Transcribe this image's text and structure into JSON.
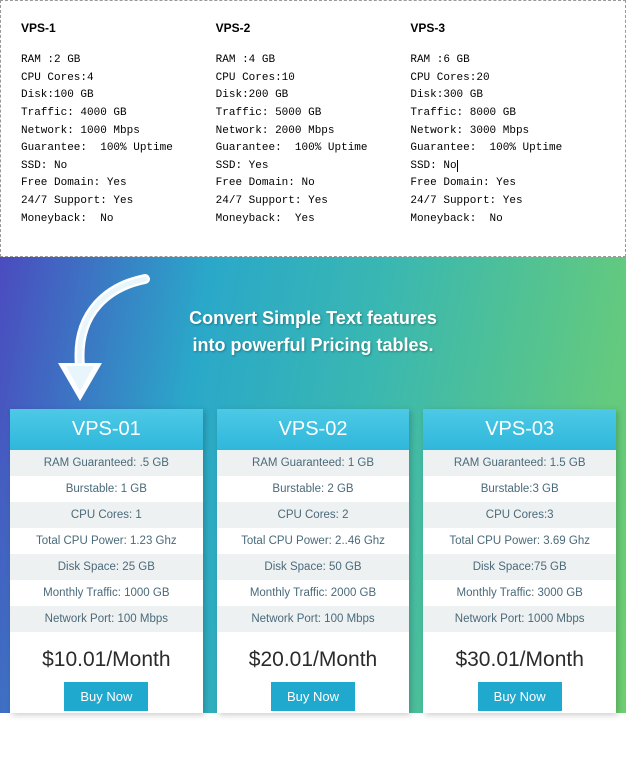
{
  "plainPlans": [
    {
      "title": "VPS-1",
      "lines": [
        "RAM :2 GB",
        "CPU Cores:4",
        "Disk:100 GB",
        "Traffic: 4000 GB",
        "Network: 1000 Mbps",
        "Guarantee:  100% Uptime",
        "SSD: No",
        "Free Domain: Yes",
        "24/7 Support: Yes",
        "Moneyback:  No"
      ]
    },
    {
      "title": "VPS-2",
      "lines": [
        "RAM :4 GB",
        "CPU Cores:10",
        "Disk:200 GB",
        "Traffic: 5000 GB",
        "Network: 2000 Mbps",
        "Guarantee:  100% Uptime",
        "SSD: Yes",
        "Free Domain: No",
        "24/7 Support: Yes",
        "Moneyback:  Yes"
      ]
    },
    {
      "title": "VPS-3",
      "lines": [
        "RAM :6 GB",
        "CPU Cores:20",
        "Disk:300 GB",
        "Traffic: 8000 GB",
        "Network: 3000 Mbps",
        "Guarantee:  100% Uptime",
        "SSD: No",
        "Free Domain: Yes",
        "24/7 Support: Yes",
        "Moneyback:  No"
      ],
      "cursorLineIndex": 6
    }
  ],
  "heroTitleLine1": "Convert Simple Text features",
  "heroTitleLine2": "into powerful Pricing tables.",
  "cards": [
    {
      "name": "VPS-01",
      "features": [
        "RAM Guaranteed: .5 GB",
        "Burstable: 1 GB",
        "CPU Cores: 1",
        "Total CPU Power: 1.23 Ghz",
        "Disk Space: 25 GB",
        "Monthly Traffic: 1000 GB",
        "Network Port: 100 Mbps"
      ],
      "price": "$10.01/Month",
      "buy": "Buy Now"
    },
    {
      "name": "VPS-02",
      "features": [
        "RAM Guaranteed: 1 GB",
        "Burstable: 2 GB",
        "CPU Cores: 2",
        "Total CPU Power: 2..46 Ghz",
        "Disk Space: 50 GB",
        "Monthly Traffic: 2000 GB",
        "Network Port: 100 Mbps"
      ],
      "price": "$20.01/Month",
      "buy": "Buy Now"
    },
    {
      "name": "VPS-03",
      "features": [
        "RAM Guaranteed: 1.5 GB",
        "Burstable:3 GB",
        "CPU Cores:3",
        "Total CPU Power: 3.69 Ghz",
        "Disk Space:75 GB",
        "Monthly Traffic: 3000 GB",
        "Network Port: 1000 Mbps"
      ],
      "price": "$30.01/Month",
      "buy": "Buy Now"
    }
  ]
}
